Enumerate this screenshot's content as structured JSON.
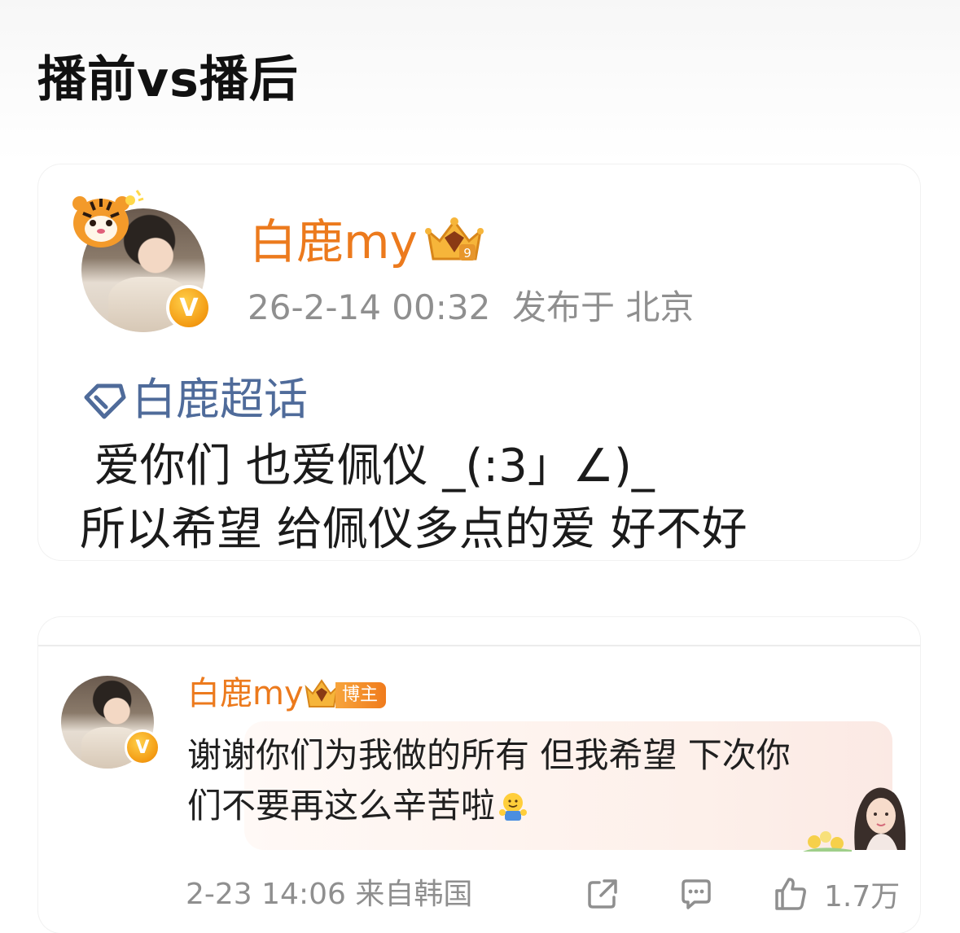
{
  "header": {
    "title": "播前vs播后"
  },
  "post": {
    "author": "白鹿my",
    "time": "26-2-14 00:32",
    "location": "发布于 北京",
    "topic": "白鹿超话",
    "line1": " 爱你们 也爱佩仪 _(:3」∠)_",
    "line2": "所以希望 给佩仪多点的爱 好不好"
  },
  "comment": {
    "author": "白鹿my",
    "badge": "博主",
    "line1": "谢谢你们为我做的所有 但我希望 下次你",
    "line2": "们不要再这么辛苦啦",
    "time": "2-23 14:06",
    "source": "来自韩国",
    "likes": "1.7万"
  },
  "icons": {
    "verified": "verified-v-badge-icon",
    "crown": "crown-membership-icon",
    "topic": "diamond-topic-icon",
    "share": "share-icon",
    "comment": "comment-icon",
    "like": "thumbs-up-icon",
    "emoji": "hug-emoji-icon"
  },
  "colors": {
    "name": "#ec7a1d",
    "topic": "#4f6b9a",
    "meta": "#8f8f8f",
    "badge": "#f39a12"
  }
}
